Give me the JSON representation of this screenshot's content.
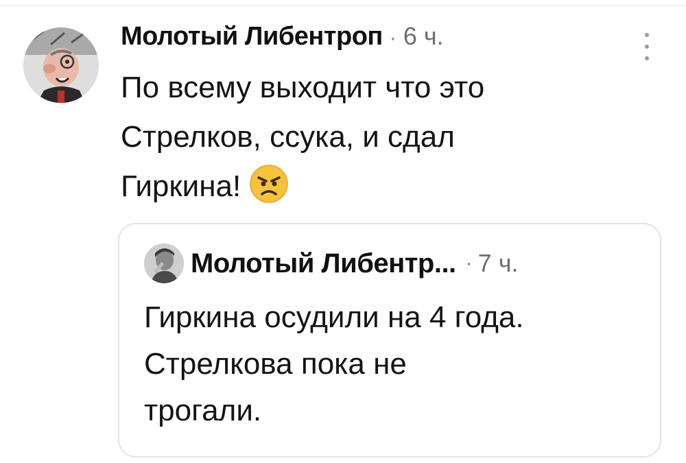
{
  "post": {
    "author": "Молотый Либентроп",
    "separator": "·",
    "time": "6 ч.",
    "avatar_icon": "pig-character-avatar",
    "menu_icon": "more-vertical-icon",
    "text_lines": [
      "По всему выходит что это",
      "Стрелков, ссука, и сдал",
      "Гиркина!"
    ],
    "emoji": "angry-face-emoji"
  },
  "quote": {
    "author": "Молотый Либентр...",
    "separator": "·",
    "time": "7 ч.",
    "avatar_icon": "boy-portrait-avatar",
    "text_lines": [
      "Гиркина осудили на 4 года.",
      "Стрелкова пока не",
      "трогали."
    ]
  },
  "colors": {
    "text": "#141414",
    "muted": "#6e6e6e",
    "border": "#e3e3e3",
    "emoji_yellow": "#f6c23e"
  }
}
